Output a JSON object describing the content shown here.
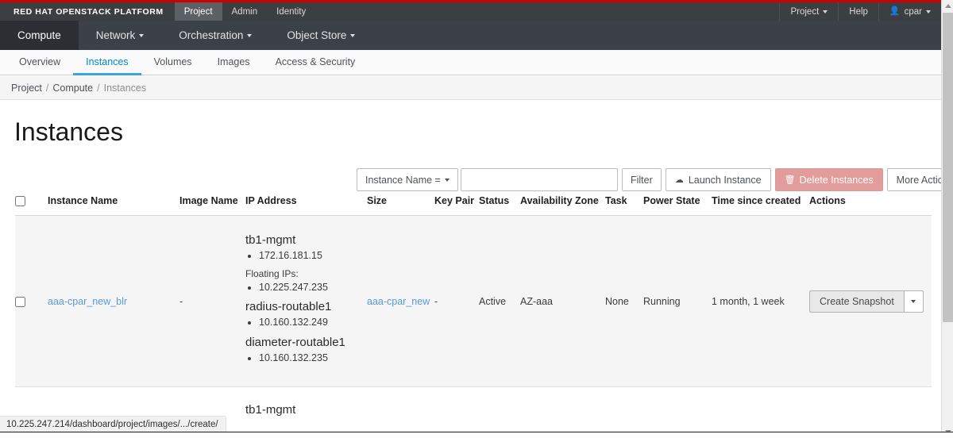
{
  "topbar": {
    "brand": "RED HAT OPENSTACK PLATFORM",
    "nav": [
      {
        "label": "Project",
        "active": true
      },
      {
        "label": "Admin",
        "active": false
      },
      {
        "label": "Identity",
        "active": false
      }
    ],
    "right": [
      {
        "label": "Project",
        "caret": true,
        "icon": ""
      },
      {
        "label": "Help",
        "caret": false,
        "icon": ""
      },
      {
        "label": "cpar",
        "caret": true,
        "icon": "user-icon"
      }
    ]
  },
  "catbar": {
    "items": [
      {
        "label": "Compute",
        "caret": false,
        "active": true
      },
      {
        "label": "Network",
        "caret": true,
        "active": false
      },
      {
        "label": "Orchestration",
        "caret": true,
        "active": false
      },
      {
        "label": "Object Store",
        "caret": true,
        "active": false
      }
    ]
  },
  "tabs": [
    {
      "label": "Overview",
      "active": false
    },
    {
      "label": "Instances",
      "active": true
    },
    {
      "label": "Volumes",
      "active": false
    },
    {
      "label": "Images",
      "active": false
    },
    {
      "label": "Access & Security",
      "active": false
    }
  ],
  "breadcrumb": {
    "items": [
      "Project",
      "Compute"
    ],
    "current": "Instances",
    "separator": "/"
  },
  "page_title": "Instances",
  "toolbar": {
    "filter_select": "Instance Name =",
    "filter_input_value": "",
    "filter_input_placeholder": "",
    "filter_button": "Filter",
    "launch_instance": "Launch Instance",
    "delete_instances": "Delete Instances",
    "more_actions": "More Actions",
    "launch_icon": "cloud-upload-icon",
    "delete_icon": "trash-icon",
    "accent_delete_bg": "#e39c9c",
    "accent_link": "#5a9ad6",
    "accent_tab": "#0088ce"
  },
  "table": {
    "columns": [
      "Instance Name",
      "Image Name",
      "IP Address",
      "Size",
      "Key Pair",
      "Status",
      "Availability Zone",
      "Task",
      "Power State",
      "Time since created",
      "Actions"
    ],
    "rows": [
      {
        "instance_name": "aaa-cpar_new_blr",
        "image_name": "-",
        "networks": [
          {
            "name": "tb1-mgmt",
            "ips": [
              "172.16.181.15"
            ],
            "extra_label": "Floating IPs:",
            "extra_ips": [
              "10.225.247.235"
            ]
          },
          {
            "name": "radius-routable1",
            "ips": [
              "10.160.132.249"
            ],
            "extra_label": "",
            "extra_ips": []
          },
          {
            "name": "diameter-routable1",
            "ips": [
              "10.160.132.235"
            ],
            "extra_label": "",
            "extra_ips": []
          }
        ],
        "size": "aaa-cpar_new",
        "key_pair": "-",
        "status": "Active",
        "availability_zone": "AZ-aaa",
        "task": "None",
        "power_state": "Running",
        "time_since_created": "1 month, 1 week",
        "action_label": "Create Snapshot"
      },
      {
        "network_name_partial": "tb1-mgmt"
      }
    ]
  },
  "statusbar": {
    "url": "10.225.247.214/dashboard/project/images/.../create/"
  }
}
